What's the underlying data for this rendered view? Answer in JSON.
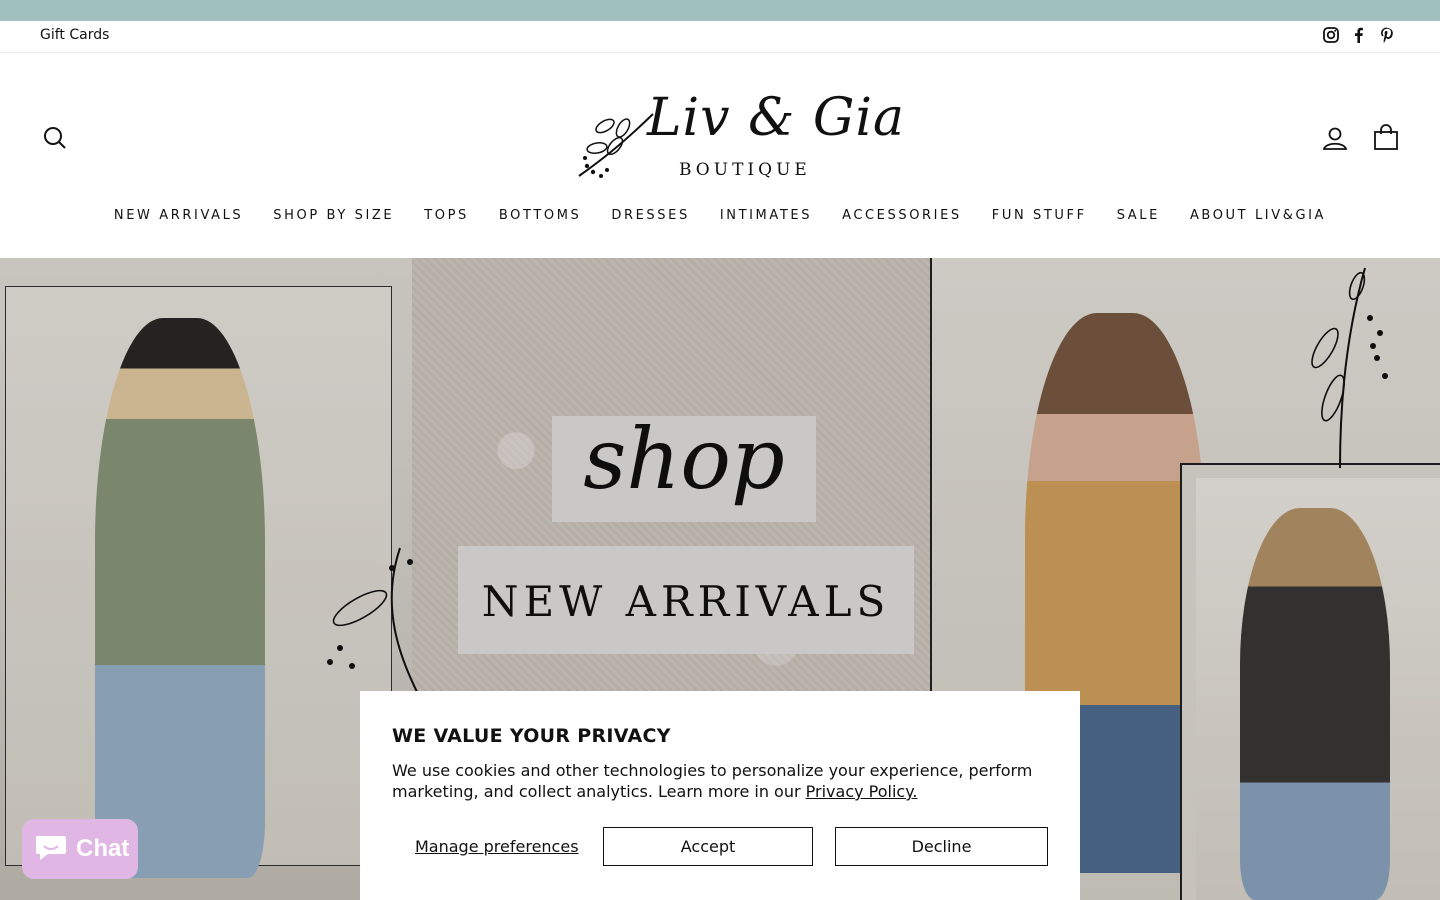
{
  "utility": {
    "gift_cards": "Gift Cards",
    "social": [
      "instagram-icon",
      "facebook-icon",
      "pinterest-icon"
    ]
  },
  "logo": {
    "script": "Liv & Gia",
    "subtitle": "BOUTIQUE"
  },
  "nav": {
    "items": [
      {
        "label": "NEW ARRIVALS"
      },
      {
        "label": "SHOP BY SIZE"
      },
      {
        "label": "TOPS"
      },
      {
        "label": "BOTTOMS"
      },
      {
        "label": "DRESSES"
      },
      {
        "label": "INTIMATES"
      },
      {
        "label": "ACCESSORIES"
      },
      {
        "label": "FUN STUFF"
      },
      {
        "label": "SALE"
      },
      {
        "label": "ABOUT LIV&GIA"
      }
    ]
  },
  "hero": {
    "shop": "shop",
    "new_arrivals": "NEW ARRIVALS"
  },
  "privacy": {
    "title": "WE VALUE YOUR PRIVACY",
    "body": "We use cookies and other technologies to personalize your experience, perform marketing, and collect analytics. Learn more in our ",
    "link": "Privacy Policy.",
    "manage": "Manage preferences",
    "accept": "Accept",
    "decline": "Decline"
  },
  "chat": {
    "label": "Chat"
  },
  "colors": {
    "announcement_bar": "#9fc0bc",
    "chat_button": "#e0b7e4"
  }
}
